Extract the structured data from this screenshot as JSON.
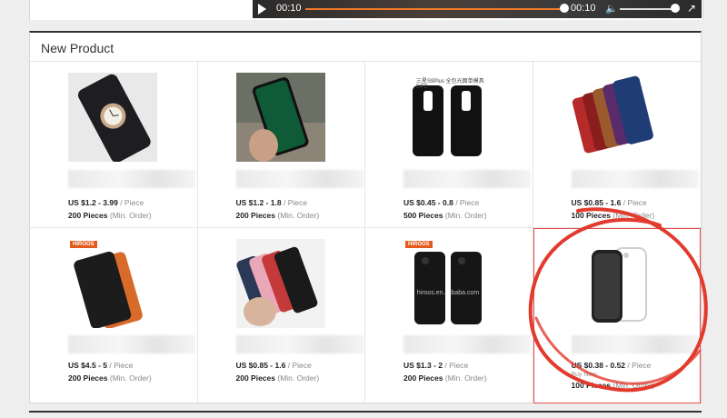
{
  "video": {
    "current_time": "00:10",
    "duration": "00:10",
    "volume_icon": "volume-icon",
    "fullscreen_icon": "fullscreen-icon"
  },
  "section": {
    "title": "New Product"
  },
  "products": [
    {
      "price_range": "US $1.2 - 3.99",
      "unit": "/ Piece",
      "moq_qty": "200 Pieces",
      "moq_label": "(Min. Order)",
      "image": "phone-case-watch-print"
    },
    {
      "price_range": "US $1.2 - 1.8",
      "unit": "/ Piece",
      "moq_qty": "200 Pieces",
      "moq_label": "(Min. Order)",
      "image": "phone-case-green-glass"
    },
    {
      "price_range": "US $0.45 - 0.8",
      "unit": "/ Piece",
      "moq_qty": "500 Pieces",
      "moq_label": "(Min. Order)",
      "image": "phone-case-black-pair",
      "caption": "三星S9Plus 全包光面单模具DPC"
    },
    {
      "price_range": "US $0.85 - 1.6",
      "unit": "/ Piece",
      "moq_qty": "100 Pieces",
      "moq_label": "(Min. Order)",
      "image": "phone-case-leather-colors"
    },
    {
      "price_range": "US $4.5 - 5",
      "unit": "/ Piece",
      "moq_qty": "200 Pieces",
      "moq_label": "(Min. Order)",
      "image": "phone-case-carbon-orange",
      "brand": "HIROOS"
    },
    {
      "price_range": "US $0.85 - 1.6",
      "unit": "/ Piece",
      "moq_qty": "200 Pieces",
      "moq_label": "(Min. Order)",
      "image": "phone-case-hand-colors"
    },
    {
      "price_range": "US $1.3 - 2",
      "unit": "/ Piece",
      "moq_qty": "200 Pieces",
      "moq_label": "(Min. Order)",
      "image": "phone-case-black-dual",
      "brand": "HIROOS",
      "watermark": "hiroos.en.alibaba.com"
    },
    {
      "price_range": "US $0.38 - 0.52",
      "unit": "/ Piece",
      "moq_qty": "100 Pieces",
      "moq_label": "(Min. Order)",
      "image": "phone-case-clear-tpu",
      "buy_now": "Buy Now"
    }
  ],
  "colors": {
    "highlight_circle": "#e23b2e",
    "card_highlight_border": "#e84a4a",
    "brand_orange": "#e25a1c",
    "video_progress": "#f07a2a"
  }
}
